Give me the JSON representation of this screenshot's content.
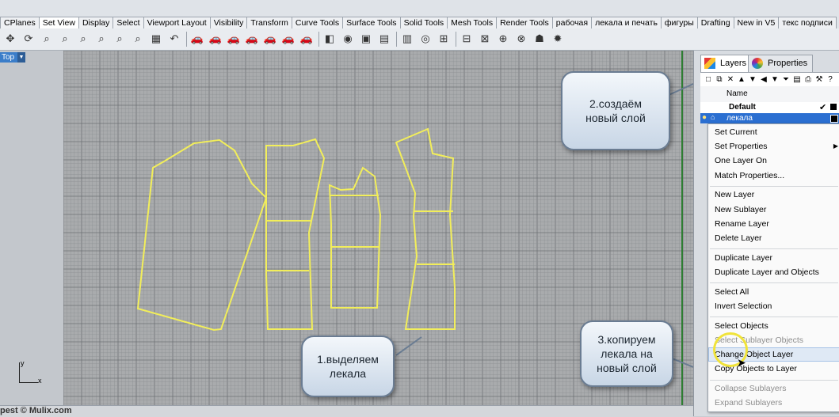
{
  "tabs": [
    {
      "label": "CPlanes",
      "active": false
    },
    {
      "label": "Set View",
      "active": true
    },
    {
      "label": "Display",
      "active": false
    },
    {
      "label": "Select",
      "active": false
    },
    {
      "label": "Viewport Layout",
      "active": false
    },
    {
      "label": "Visibility",
      "active": false
    },
    {
      "label": "Transform",
      "active": false
    },
    {
      "label": "Curve Tools",
      "active": false
    },
    {
      "label": "Surface Tools",
      "active": false
    },
    {
      "label": "Solid Tools",
      "active": false
    },
    {
      "label": "Mesh Tools",
      "active": false
    },
    {
      "label": "Render Tools",
      "active": false
    },
    {
      "label": "рабочая",
      "active": false
    },
    {
      "label": "лекала и печать",
      "active": false
    },
    {
      "label": "фигуры",
      "active": false
    },
    {
      "label": "Drafting",
      "active": false
    },
    {
      "label": "New in V5",
      "active": false
    },
    {
      "label": "текс подписи",
      "active": false
    }
  ],
  "toolbar_icons": [
    "pan-icon",
    "rotate-view-icon",
    "zoom-dynamic-icon",
    "zoom-window-icon",
    "zoom-extents-icon",
    "zoom-selected-icon",
    "zoom-all-icon",
    "zoom-target-icon",
    "four-view-icon",
    "undo-view-icon",
    "red-car-icon",
    "car-shaded-icon",
    "car-rendered-icon",
    "car-ghosted-icon",
    "car-xray-icon",
    "car-technical-icon",
    "car-artistic-icon",
    "set-camera-icon",
    "capture-icon",
    "named-views-icon",
    "named-cplanes-icon",
    "perspective-icon",
    "snapshot-icon",
    "ortho-icon",
    "plan-icon",
    "viewport-icon",
    "grid-axes-icon",
    "turntable-icon",
    "walkabout-icon",
    "sun-icon"
  ],
  "viewport": {
    "name": "Top",
    "axis_x": "x",
    "axis_y": "y"
  },
  "panel": {
    "layers_tab": "Layers",
    "properties_tab": "Properties",
    "name_header": "Name",
    "layers": [
      {
        "name": "Default",
        "current": true,
        "color": "#000000"
      },
      {
        "name": "лекала",
        "current": false,
        "color": "#000000",
        "selected": true
      }
    ]
  },
  "context_menu": [
    {
      "label": "Set Current",
      "enabled": true
    },
    {
      "label": "Set Properties",
      "enabled": true,
      "submenu": true
    },
    {
      "label": "One Layer On",
      "enabled": true
    },
    {
      "label": "Match Properties...",
      "enabled": true
    },
    {
      "sep": true
    },
    {
      "label": "New Layer",
      "enabled": true
    },
    {
      "label": "New Sublayer",
      "enabled": true
    },
    {
      "label": "Rename Layer",
      "enabled": true
    },
    {
      "label": "Delete Layer",
      "enabled": true
    },
    {
      "sep": true
    },
    {
      "label": "Duplicate Layer",
      "enabled": true
    },
    {
      "label": "Duplicate Layer and Objects",
      "enabled": true
    },
    {
      "sep": true
    },
    {
      "label": "Select All",
      "enabled": true
    },
    {
      "label": "Invert Selection",
      "enabled": true
    },
    {
      "sep": true
    },
    {
      "label": "Select Objects",
      "enabled": true
    },
    {
      "label": "Select Sublayer Objects",
      "enabled": false
    },
    {
      "label": "Change Object Layer",
      "enabled": true,
      "highlighted": true
    },
    {
      "label": "Copy Objects to Layer",
      "enabled": true
    },
    {
      "sep": true
    },
    {
      "label": "Collapse Sublayers",
      "enabled": false
    },
    {
      "label": "Expand Sublayers",
      "enabled": false
    }
  ],
  "callouts": {
    "step1": "1.выделяем лекала",
    "step2": "2.создаём новый слой",
    "step3": "3.копируем лекала на новый слой"
  },
  "status": {
    "text": "pest © Mulix.com"
  },
  "colors": {
    "grid_bg": "#a9abad",
    "grid_line": "#8d9094",
    "grid_major": "#6f7276",
    "pattern_curve": "#f2ee5a",
    "green_axis": "#2e7d32",
    "selection": "#2b6fd1"
  }
}
